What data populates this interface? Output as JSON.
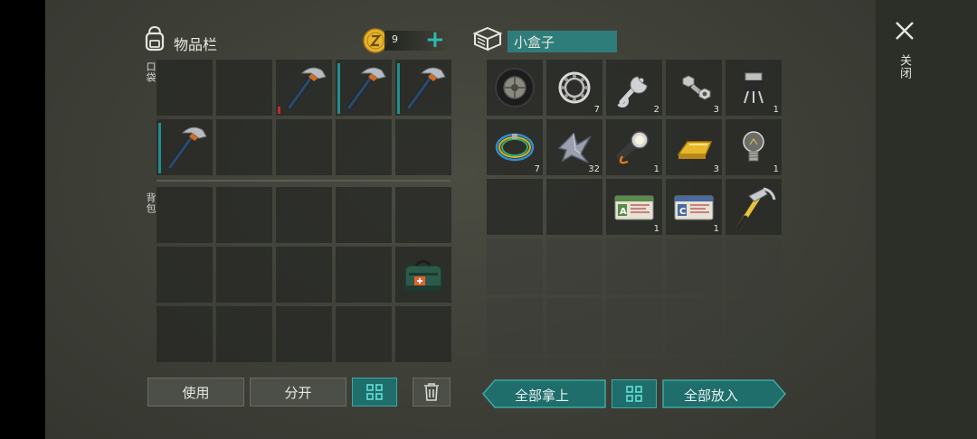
{
  "inventory": {
    "title": "物品栏",
    "pocket_label": "口袋",
    "backpack_label": "背包",
    "coins": "9",
    "pocket_slots": [
      {
        "item": "",
        "count": ""
      },
      {
        "item": "",
        "count": ""
      },
      {
        "item": "hatchet-icon",
        "count": "",
        "durability": "red"
      },
      {
        "item": "hatchet-icon",
        "count": "",
        "durability": "teal"
      },
      {
        "item": "hatchet-icon",
        "count": "",
        "durability": "teal"
      },
      {
        "item": "hatchet-icon",
        "count": "",
        "durability": "teal"
      },
      {
        "item": "",
        "count": ""
      },
      {
        "item": "",
        "count": ""
      },
      {
        "item": "",
        "count": ""
      },
      {
        "item": "",
        "count": ""
      }
    ],
    "backpack_slots": [
      {
        "item": ""
      },
      {
        "item": ""
      },
      {
        "item": ""
      },
      {
        "item": ""
      },
      {
        "item": ""
      },
      {
        "item": ""
      },
      {
        "item": ""
      },
      {
        "item": ""
      },
      {
        "item": ""
      },
      {
        "item": "first-aid-bag-icon"
      },
      {
        "item": ""
      },
      {
        "item": ""
      },
      {
        "item": ""
      },
      {
        "item": ""
      },
      {
        "item": ""
      }
    ]
  },
  "container": {
    "title": "小盒子",
    "slots": [
      {
        "item": "tire-icon",
        "count": ""
      },
      {
        "item": "bearing-icon",
        "count": "7"
      },
      {
        "item": "wrench-icon",
        "count": "2"
      },
      {
        "item": "bolt-nut-icon",
        "count": "3"
      },
      {
        "item": "transistor-icon",
        "count": "1"
      },
      {
        "item": "wire-coil-icon",
        "count": "7"
      },
      {
        "item": "scrap-metal-icon",
        "count": "32"
      },
      {
        "item": "flashlight-icon",
        "count": "1"
      },
      {
        "item": "gold-bar-icon",
        "count": "3"
      },
      {
        "item": "light-bulb-icon",
        "count": "1"
      },
      {
        "item": "",
        "count": ""
      },
      {
        "item": "",
        "count": ""
      },
      {
        "item": "army-card-a-icon",
        "count": "1"
      },
      {
        "item": "army-card-c-icon",
        "count": "1"
      },
      {
        "item": "claw-hammer-icon",
        "count": ""
      }
    ]
  },
  "buttons": {
    "use": "使用",
    "split": "分开",
    "take_all": "全部拿上",
    "put_all": "全部放入"
  },
  "close_label": "关闭",
  "colors": {
    "accent": "#1f6e6c",
    "accent_border": "#3fa8a2",
    "coin": "#e8b52a",
    "plus": "#2fb8a8"
  }
}
